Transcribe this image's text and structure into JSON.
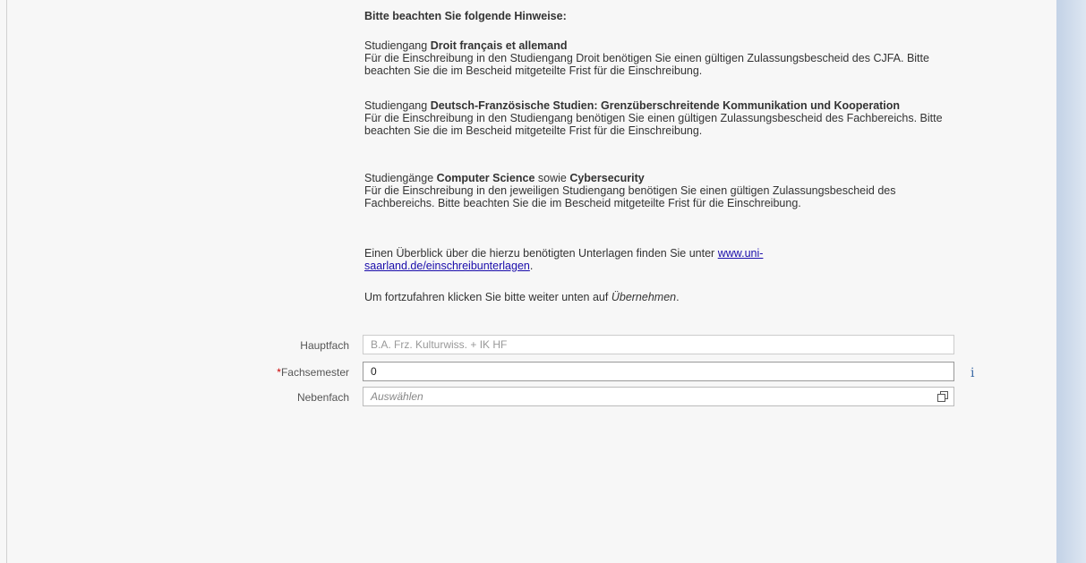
{
  "notice": {
    "title": "Bitte beachten Sie folgende Hinweise:",
    "blocks": [
      {
        "head_prefix": "Studiengang ",
        "head_bold": "Droit français et allemand",
        "body": "Für die Einschreibung in den Studiengang Droit benötigen Sie einen gültigen Zulassungsbescheid des CJFA. Bitte beachten Sie die im Bescheid mitgeteilte Frist für die Einschreibung."
      },
      {
        "head_prefix": "Studiengang ",
        "head_bold": "Deutsch-Französische Studien: Grenzüberschreitende Kommunikation und Kooperation",
        "body": "Für die Einschreibung in den Studiengang benötigen Sie einen gültigen Zulassungsbescheid des Fachbereichs. Bitte beachten Sie die im Bescheid mitgeteilte Frist für die Einschreibung."
      },
      {
        "head_prefix": "Studiengänge ",
        "head_bold": "Computer Science",
        "head_mid": " sowie ",
        "head_bold2": "Cybersecurity",
        "body": "Für die Einschreibung in den jeweiligen Studiengang benötigen Sie einen gültigen Zulassungsbescheid des Fachbereichs. Bitte beachten Sie die im Bescheid mitgeteilte Frist für die Einschreibung."
      }
    ],
    "overview_prefix": "Einen Überblick über die hierzu benötigten Unterlagen finden Sie unter ",
    "overview_link": "www.uni-saarland.de/einschreibunterlagen",
    "overview_suffix": ".",
    "continue_prefix": "Um fortzufahren klicken Sie bitte weiter unten auf ",
    "continue_emph": "Übernehmen",
    "continue_suffix": "."
  },
  "form": {
    "hauptfach": {
      "label": "Hauptfach",
      "value": "B.A. Frz. Kulturwiss. + IK HF"
    },
    "fachsemester": {
      "required_mark": "*",
      "label": "Fachsemester",
      "value": "0"
    },
    "nebenfach": {
      "label": "Nebenfach",
      "placeholder": "Auswählen"
    }
  },
  "icons": {
    "info": "info-icon",
    "popup": "value-help-icon"
  }
}
